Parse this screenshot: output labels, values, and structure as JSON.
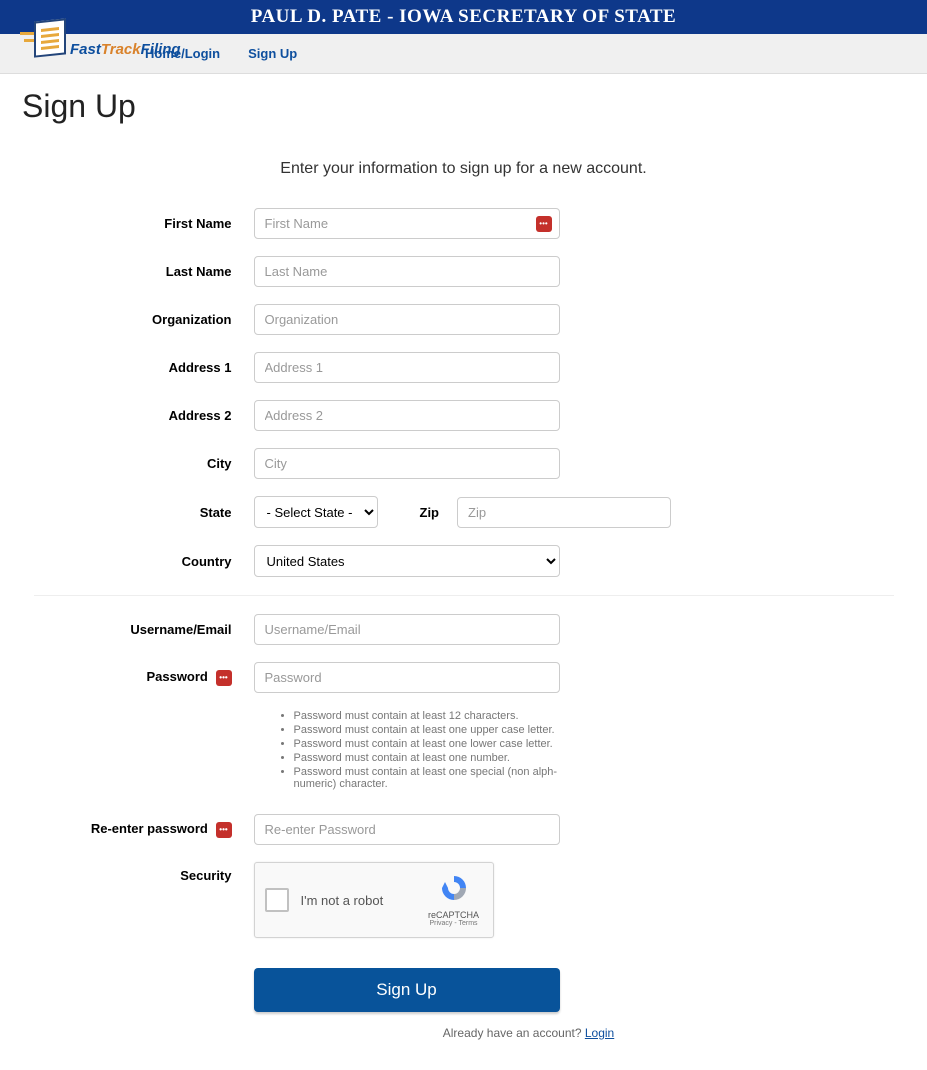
{
  "banner": {
    "title": "PAUL D. PATE - IOWA SECRETARY OF STATE"
  },
  "logo": {
    "fast": "Fast",
    "track": "Track",
    "filing": "Filing"
  },
  "nav": {
    "home": "Home/Login",
    "signup": "Sign Up"
  },
  "page": {
    "title": "Sign Up",
    "instruction": "Enter your information to sign up for a new account."
  },
  "form": {
    "first_name": {
      "label": "First Name",
      "placeholder": "First Name",
      "value": ""
    },
    "last_name": {
      "label": "Last Name",
      "placeholder": "Last Name",
      "value": ""
    },
    "organization": {
      "label": "Organization",
      "placeholder": "Organization",
      "value": ""
    },
    "address1": {
      "label": "Address 1",
      "placeholder": "Address 1",
      "value": ""
    },
    "address2": {
      "label": "Address 2",
      "placeholder": "Address 2",
      "value": ""
    },
    "city": {
      "label": "City",
      "placeholder": "City",
      "value": ""
    },
    "state": {
      "label": "State",
      "selected": "- Select State -"
    },
    "zip": {
      "label": "Zip",
      "placeholder": "Zip",
      "value": ""
    },
    "country": {
      "label": "Country",
      "selected": "United States"
    },
    "username": {
      "label": "Username/Email",
      "placeholder": "Username/Email",
      "value": ""
    },
    "password": {
      "label": "Password",
      "placeholder": "Password",
      "value": ""
    },
    "password_rules": [
      "Password must contain at least 12 characters.",
      "Password must contain at least one upper case letter.",
      "Password must contain at least one lower case letter.",
      "Password must contain at least one number.",
      "Password must contain at least one special (non alph-numeric) character."
    ],
    "password2": {
      "label": "Re-enter password",
      "placeholder": "Re-enter Password",
      "value": ""
    },
    "security": {
      "label": "Security",
      "captcha_text": "I'm not a robot",
      "brand": "reCAPTCHA",
      "links": "Privacy - Terms"
    },
    "submit": "Sign Up"
  },
  "footer": {
    "prompt": "Already have an account? ",
    "login": "Login"
  }
}
